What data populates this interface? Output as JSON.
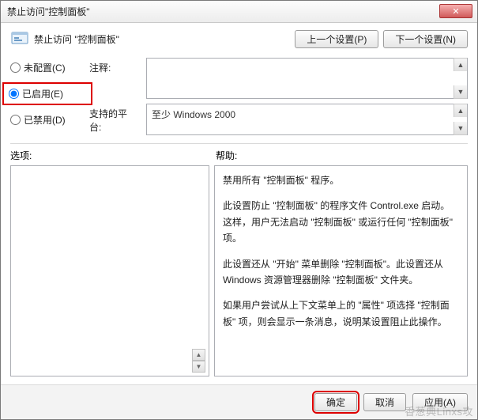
{
  "titlebar": {
    "title": "禁止访问\"控制面板\"",
    "close": "✕"
  },
  "header": {
    "policy_title": "禁止访问 \"控制面板\"",
    "prev_btn": "上一个设置(P)",
    "next_btn": "下一个设置(N)"
  },
  "radios": {
    "not_configured": "未配置(C)",
    "enabled": "已启用(E)",
    "disabled": "已禁用(D)",
    "selected": "enabled"
  },
  "fields": {
    "comment_label": "注释:",
    "comment_value": "",
    "platform_label": "支持的平台:",
    "platform_value": "至少 Windows 2000"
  },
  "sections": {
    "options_label": "选项:",
    "help_label": "帮助:"
  },
  "help": {
    "p1": "禁用所有 \"控制面板\" 程序。",
    "p2": "此设置防止 \"控制面板\" 的程序文件 Control.exe 启动。这样，用户无法启动 \"控制面板\" 或运行任何 \"控制面板\" 项。",
    "p3": "此设置还从 \"开始\" 菜单删除 \"控制面板\"。此设置还从 Windows 资源管理器删除 \"控制面板\" 文件夹。",
    "p4": "如果用户尝试从上下文菜单上的 \"属性\" 项选择 \"控制面板\" 项，则会显示一条消息，说明某设置阻止此操作。"
  },
  "footer": {
    "ok": "确定",
    "cancel": "取消",
    "apply": "应用(A)"
  },
  "watermark": "香葱典Linxs攻"
}
